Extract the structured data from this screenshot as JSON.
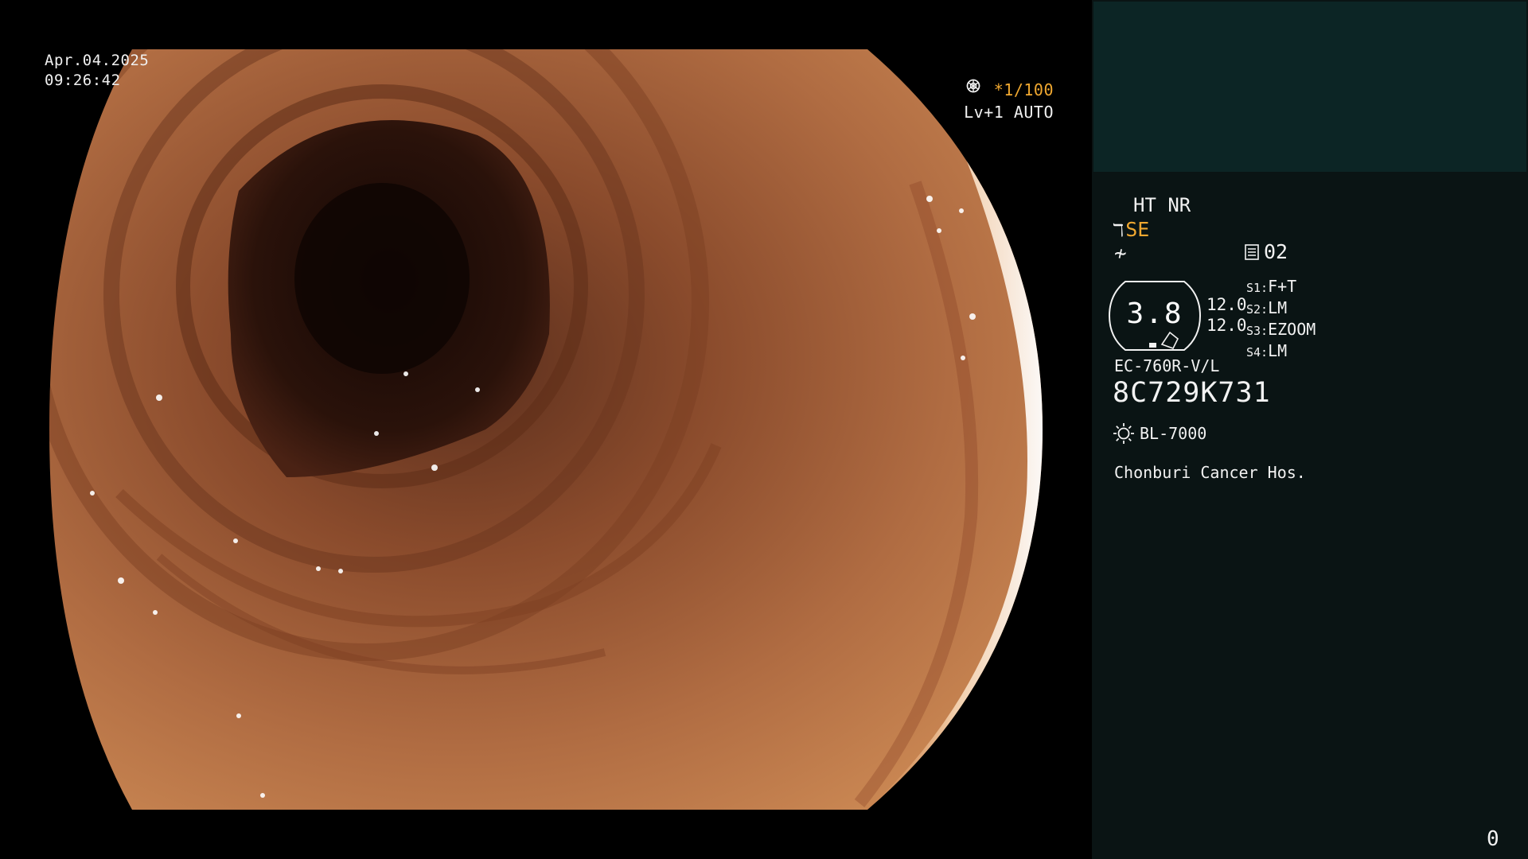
{
  "overlay": {
    "date": "Apr.04.2025",
    "time": "09:26:42",
    "shutter": "*1/100",
    "shutter_icon": "aperture-icon",
    "exposure": "Lv+1 AUTO",
    "exposure_icon": "iris-icon"
  },
  "panel": {
    "ht_nr": "HT NR",
    "mode": "SE",
    "mode_icon": "enhancement-mode-icon",
    "flat_icon": "structure-icon",
    "memory_label": "02",
    "memory_icon": "memory-icon",
    "zoom": "3.8",
    "zoom_steps": [
      "12.0",
      "12.0"
    ],
    "switches": [
      {
        "key": "S1:",
        "value": "F+T"
      },
      {
        "key": "S2:",
        "value": "LM"
      },
      {
        "key": "S3:",
        "value": "EZOOM"
      },
      {
        "key": "S4:",
        "value": "LM"
      }
    ],
    "scope_model": "EC-760R-V/L",
    "scope_serial": "8C729K731",
    "light_icon": "light-source-icon",
    "light_source": "BL-7000",
    "hospital": "Chonburi Cancer Hos.",
    "counter": "0"
  },
  "colors": {
    "mucosa": "#b8734a",
    "panel_bg": "#0a1414",
    "panel_header": "#0c2525",
    "accent": "#f0a830"
  }
}
